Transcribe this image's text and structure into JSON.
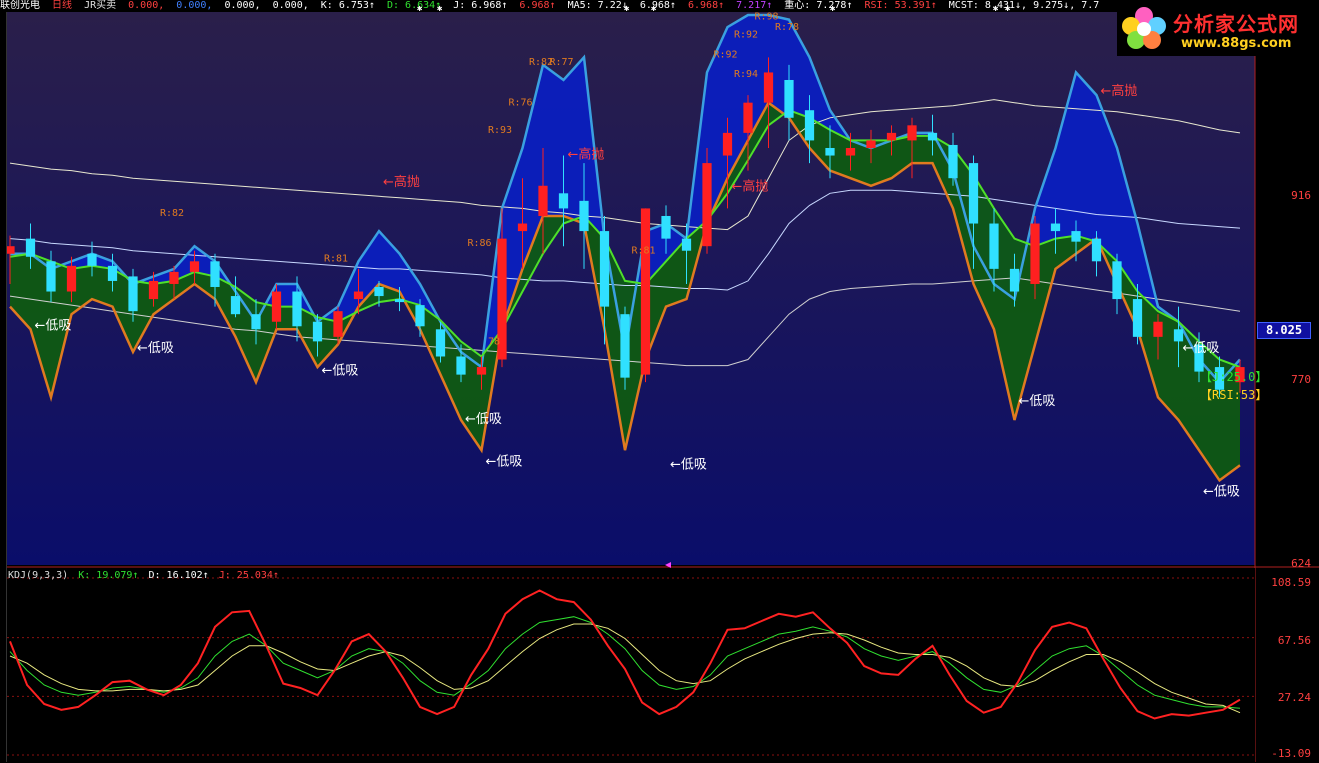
{
  "top_bar": {
    "stock_name": "联创光电",
    "period": "日线",
    "formula": "JR买卖",
    "vals1": [
      "0.000,",
      "0.000,",
      "0.000,",
      "0.000,"
    ],
    "k": "K: 6.753↑",
    "d": "D: 6.634↑",
    "j": "J: 6.968↑",
    "j2": "6.968↑",
    "ma5": "MA5: 7.22↓",
    "ma5b": "6.968↑",
    "ma5c": "6.968↑",
    "ma5d": "7.217↑",
    "zx": "重心: 7.278↑",
    "rsi": "RSI: 53.391↑",
    "mcst": "MCST: 8.431↓, 9.275↓, 7.7"
  },
  "logo": {
    "text": "分析家公式网",
    "url": "www.88gs.com"
  },
  "right_axis": {
    "price_labels": [
      "916",
      "770",
      "624"
    ],
    "current_price": "8.025",
    "indicator_labels": [
      "108.59",
      "67.56",
      "27.24",
      "-13.09"
    ]
  },
  "side_tags": {
    "j": "【J:25.0】",
    "rsi": "【RSI:53】"
  },
  "kdj_header": {
    "name": "KDJ(9,3,3)",
    "k": "K: 19.079↑",
    "d": "D: 16.102↑",
    "j": "J: 25.034↑"
  },
  "colors": {
    "bg_top": "#2a1f4a",
    "bg_bottom": "#0a0d6a",
    "up": "#ff2020",
    "down": "#30e0ff",
    "green_fill": "#0f5a12",
    "blue_fill": "#0b1fbf",
    "orange": "#e07a20",
    "cyanline": "#3aa0e0",
    "greenline": "#4ee02a",
    "kdj_red": "#ff2222",
    "kdj_green": "#30e030",
    "kdj_yellow": "#e8e880"
  },
  "chart_data": [
    {
      "type": "candlestick",
      "title": "",
      "ylim": [
        6.24,
        9.9
      ],
      "y_ticks": [
        9.16,
        7.7,
        6.24
      ],
      "annotations": [
        {
          "text": "R:82",
          "index": 8,
          "value": 8.55
        },
        {
          "text": "R:81",
          "index": 16,
          "value": 8.25
        },
        {
          "text": "R:86",
          "index": 23,
          "value": 8.35
        },
        {
          "text": "R:93",
          "index": 24,
          "value": 9.1
        },
        {
          "text": "R:76",
          "index": 25,
          "value": 9.28
        },
        {
          "text": "R:82",
          "index": 26,
          "value": 9.55
        },
        {
          "text": "R:77",
          "index": 27,
          "value": 9.55
        },
        {
          "text": "R:81",
          "index": 31,
          "value": 8.3
        },
        {
          "text": "R:92",
          "index": 36,
          "value": 9.73
        },
        {
          "text": "R:92",
          "index": 35,
          "value": 9.6
        },
        {
          "text": "R:94",
          "index": 36,
          "value": 9.47
        },
        {
          "text": "R:98",
          "index": 37,
          "value": 9.85
        },
        {
          "text": "R:78",
          "index": 38,
          "value": 9.78
        },
        {
          "text": "78",
          "index": 24,
          "value": 7.7
        }
      ],
      "signals": [
        {
          "text": "←低吸",
          "index": 1,
          "value": 7.8
        },
        {
          "text": "←低吸",
          "index": 6,
          "value": 7.65
        },
        {
          "text": "←低吸",
          "index": 15,
          "value": 7.5
        },
        {
          "text": "←高抛",
          "index": 18,
          "value": 8.75
        },
        {
          "text": "←低吸",
          "index": 22,
          "value": 7.18
        },
        {
          "text": "←低吸",
          "index": 23,
          "value": 6.9
        },
        {
          "text": "←高抛",
          "index": 27,
          "value": 8.93
        },
        {
          "text": "←低吸",
          "index": 32,
          "value": 6.88
        },
        {
          "text": "←高抛",
          "index": 35,
          "value": 8.72
        },
        {
          "text": "←高抛",
          "index": 39,
          "value": 10.1
        },
        {
          "text": "←低吸",
          "index": 49,
          "value": 7.3
        },
        {
          "text": "←高抛",
          "index": 53,
          "value": 9.35
        },
        {
          "text": "←低吸",
          "index": 57,
          "value": 7.65
        },
        {
          "text": "←低吸",
          "index": 58,
          "value": 6.7
        }
      ],
      "candles": [
        [
          8.3,
          8.42,
          8.35,
          8.1
        ],
        [
          8.4,
          8.5,
          8.28,
          8.2
        ],
        [
          8.25,
          8.32,
          8.05,
          7.98
        ],
        [
          8.05,
          8.28,
          8.22,
          7.98
        ],
        [
          8.3,
          8.38,
          8.22,
          8.15
        ],
        [
          8.22,
          8.3,
          8.12,
          8.05
        ],
        [
          8.15,
          8.2,
          7.92,
          7.85
        ],
        [
          8.0,
          8.18,
          8.12,
          7.95
        ],
        [
          8.1,
          8.22,
          8.18,
          8.0
        ],
        [
          8.18,
          8.32,
          8.25,
          8.1
        ],
        [
          8.25,
          8.3,
          8.08,
          7.95
        ],
        [
          8.02,
          8.15,
          7.9,
          7.88
        ],
        [
          7.9,
          8.0,
          7.8,
          7.7
        ],
        [
          7.85,
          8.1,
          8.05,
          7.8
        ],
        [
          8.05,
          8.15,
          7.82,
          7.72
        ],
        [
          7.85,
          7.9,
          7.72,
          7.62
        ],
        [
          7.75,
          7.95,
          7.92,
          7.7
        ],
        [
          8.0,
          8.2,
          8.05,
          7.9
        ],
        [
          8.08,
          8.12,
          8.02,
          7.95
        ],
        [
          8.0,
          8.08,
          7.98,
          7.92
        ],
        [
          7.96,
          8.0,
          7.82,
          7.75
        ],
        [
          7.8,
          7.85,
          7.62,
          7.58
        ],
        [
          7.62,
          7.7,
          7.5,
          7.45
        ],
        [
          7.5,
          7.62,
          7.55,
          7.4
        ],
        [
          7.6,
          8.6,
          8.4,
          7.55
        ],
        [
          8.45,
          8.8,
          8.5,
          8.2
        ],
        [
          8.55,
          9.0,
          8.75,
          8.3
        ],
        [
          8.7,
          8.95,
          8.6,
          8.35
        ],
        [
          8.65,
          8.9,
          8.45,
          8.2
        ],
        [
          8.45,
          8.55,
          7.95,
          7.7
        ],
        [
          7.9,
          7.95,
          7.48,
          7.4
        ],
        [
          7.5,
          8.6,
          8.6,
          7.45
        ],
        [
          8.55,
          8.62,
          8.4,
          8.3
        ],
        [
          8.4,
          8.5,
          8.32,
          8.1
        ],
        [
          8.35,
          9.0,
          8.9,
          8.3
        ],
        [
          8.95,
          9.2,
          9.1,
          8.6
        ],
        [
          9.1,
          9.35,
          9.3,
          8.85
        ],
        [
          9.3,
          9.6,
          9.5,
          9.0
        ],
        [
          9.45,
          9.55,
          9.2,
          9.05
        ],
        [
          9.25,
          9.35,
          9.05,
          8.9
        ],
        [
          9.0,
          9.15,
          8.95,
          8.8
        ],
        [
          8.95,
          9.1,
          9.0,
          8.85
        ],
        [
          9.0,
          9.12,
          9.05,
          8.9
        ],
        [
          9.05,
          9.15,
          9.1,
          8.95
        ],
        [
          9.05,
          9.2,
          9.15,
          8.8
        ],
        [
          9.1,
          9.22,
          9.05,
          8.95
        ],
        [
          9.02,
          9.1,
          8.8,
          8.75
        ],
        [
          8.9,
          8.95,
          8.5,
          8.2
        ],
        [
          8.5,
          8.6,
          8.2,
          8.05
        ],
        [
          8.2,
          8.3,
          8.05,
          7.95
        ],
        [
          8.1,
          8.55,
          8.5,
          8.0
        ],
        [
          8.5,
          8.6,
          8.45,
          8.3
        ],
        [
          8.45,
          8.52,
          8.38,
          8.25
        ],
        [
          8.4,
          8.45,
          8.25,
          8.15
        ],
        [
          8.25,
          8.3,
          8.0,
          7.9
        ],
        [
          8.0,
          8.1,
          7.75,
          7.7
        ],
        [
          7.75,
          7.9,
          7.85,
          7.6
        ],
        [
          7.8,
          7.95,
          7.72,
          7.55
        ],
        [
          7.7,
          7.78,
          7.52,
          7.45
        ],
        [
          7.55,
          7.62,
          7.4,
          7.35
        ],
        [
          7.45,
          7.6,
          7.55,
          7.38
        ]
      ],
      "ma_short": [
        8.28,
        8.3,
        8.25,
        8.2,
        8.22,
        8.2,
        8.12,
        8.1,
        8.12,
        8.18,
        8.15,
        8.08,
        7.98,
        7.95,
        7.95,
        7.88,
        7.85,
        7.92,
        7.98,
        8.0,
        7.96,
        7.86,
        7.72,
        7.62,
        7.8,
        8.05,
        8.3,
        8.5,
        8.55,
        8.4,
        8.12,
        8.1,
        8.25,
        8.4,
        8.52,
        8.7,
        8.92,
        9.15,
        9.25,
        9.2,
        9.12,
        9.05,
        9.05,
        9.05,
        9.08,
        9.08,
        9.0,
        8.82,
        8.6,
        8.4,
        8.35,
        8.4,
        8.42,
        8.38,
        8.25,
        8.05,
        7.92,
        7.85,
        7.72,
        7.6,
        7.55
      ],
      "mcst1": [
        8.9,
        8.88,
        8.86,
        8.85,
        8.83,
        8.82,
        8.8,
        8.79,
        8.78,
        8.77,
        8.76,
        8.75,
        8.74,
        8.73,
        8.72,
        8.71,
        8.7,
        8.69,
        8.68,
        8.67,
        8.66,
        8.65,
        8.64,
        8.62,
        8.61,
        8.6,
        8.58,
        8.57,
        8.55,
        8.54,
        8.52,
        8.5,
        8.49,
        8.48,
        8.47,
        8.46,
        8.55,
        8.8,
        9.05,
        9.15,
        9.2,
        9.22,
        9.24,
        9.25,
        9.26,
        9.27,
        9.28,
        9.3,
        9.32,
        9.3,
        9.28,
        9.27,
        9.26,
        9.25,
        9.24,
        9.22,
        9.2,
        9.18,
        9.15,
        9.12,
        9.1
      ],
      "mcst2": [
        8.4,
        8.39,
        8.37,
        8.36,
        8.35,
        8.34,
        8.32,
        8.31,
        8.3,
        8.29,
        8.28,
        8.27,
        8.26,
        8.25,
        8.24,
        8.23,
        8.22,
        8.21,
        8.2,
        8.2,
        8.19,
        8.18,
        8.17,
        8.16,
        8.14,
        8.13,
        8.12,
        8.12,
        8.11,
        8.1,
        8.09,
        8.09,
        8.08,
        8.07,
        8.07,
        8.06,
        8.12,
        8.3,
        8.5,
        8.62,
        8.7,
        8.72,
        8.72,
        8.72,
        8.71,
        8.7,
        8.69,
        8.68,
        8.66,
        8.64,
        8.62,
        8.6,
        8.58,
        8.56,
        8.55,
        8.54,
        8.52,
        8.5,
        8.49,
        8.48,
        8.47
      ],
      "mcst3": [
        8.02,
        8.0,
        7.98,
        7.96,
        7.94,
        7.92,
        7.9,
        7.88,
        7.86,
        7.84,
        7.82,
        7.8,
        7.79,
        7.77,
        7.75,
        7.74,
        7.73,
        7.72,
        7.71,
        7.7,
        7.69,
        7.68,
        7.67,
        7.66,
        7.65,
        7.64,
        7.63,
        7.62,
        7.61,
        7.6,
        7.59,
        7.58,
        7.57,
        7.56,
        7.56,
        7.56,
        7.6,
        7.75,
        7.9,
        8.0,
        8.05,
        8.07,
        8.08,
        8.09,
        8.1,
        8.1,
        8.11,
        8.12,
        8.13,
        8.14,
        8.12,
        8.1,
        8.08,
        8.06,
        8.04,
        8.02,
        8.0,
        7.98,
        7.96,
        7.94,
        7.92
      ],
      "band_upper": [
        8.3,
        8.3,
        8.2,
        8.25,
        8.3,
        8.25,
        8.1,
        8.15,
        8.2,
        8.35,
        8.25,
        8.05,
        7.85,
        8.1,
        8.1,
        7.85,
        7.95,
        8.25,
        8.45,
        8.3,
        8.1,
        7.85,
        7.65,
        7.55,
        8.6,
        9.0,
        9.55,
        9.45,
        9.6,
        8.4,
        7.65,
        8.45,
        8.5,
        8.4,
        9.5,
        9.8,
        9.88,
        9.88,
        9.85,
        9.6,
        9.25,
        9.05,
        9.0,
        9.05,
        9.1,
        9.1,
        8.85,
        8.35,
        8.1,
        8.0,
        8.6,
        9.0,
        9.5,
        9.35,
        9.0,
        8.5,
        7.95,
        7.85,
        7.6,
        7.45,
        7.6
      ],
      "band_lower": [
        7.95,
        7.8,
        7.35,
        7.9,
        8.0,
        7.95,
        7.65,
        7.9,
        8.0,
        8.1,
        8.0,
        7.75,
        7.45,
        7.8,
        7.8,
        7.55,
        7.7,
        7.95,
        8.1,
        8.05,
        7.8,
        7.5,
        7.2,
        7.0,
        7.8,
        8.2,
        8.55,
        8.55,
        8.5,
        7.8,
        7.0,
        7.6,
        7.95,
        8.0,
        8.5,
        8.8,
        9.05,
        9.3,
        9.2,
        9.0,
        8.85,
        8.8,
        8.75,
        8.8,
        8.9,
        8.9,
        8.6,
        8.1,
        7.8,
        7.2,
        7.7,
        8.2,
        8.3,
        8.4,
        8.1,
        7.8,
        7.35,
        7.2,
        7.0,
        6.8,
        6.9
      ]
    },
    {
      "type": "line",
      "title": "KDJ(9,3,3)",
      "ylim": [
        -13.09,
        108.59
      ],
      "y_ticks": [
        108.59,
        67.56,
        27.24,
        -13.09
      ],
      "series": [
        {
          "name": "K",
          "values": [
            58,
            45,
            35,
            30,
            28,
            30,
            33,
            34,
            32,
            30,
            33,
            40,
            55,
            65,
            70,
            62,
            50,
            45,
            40,
            45,
            55,
            60,
            58,
            50,
            38,
            30,
            28,
            36,
            45,
            60,
            70,
            78,
            80,
            82,
            78,
            70,
            60,
            45,
            35,
            32,
            34,
            42,
            55,
            60,
            65,
            70,
            72,
            75,
            72,
            68,
            60,
            55,
            52,
            55,
            58,
            50,
            40,
            32,
            30,
            35,
            45,
            55,
            60,
            62,
            55,
            45,
            35,
            28,
            25,
            22,
            20,
            20,
            19
          ]
        },
        {
          "name": "D",
          "values": [
            55,
            50,
            42,
            36,
            32,
            31,
            31,
            32,
            32,
            31,
            32,
            35,
            45,
            55,
            62,
            62,
            57,
            51,
            46,
            45,
            50,
            55,
            58,
            55,
            47,
            38,
            32,
            33,
            38,
            48,
            58,
            67,
            73,
            77,
            77,
            74,
            67,
            56,
            45,
            38,
            36,
            38,
            46,
            53,
            58,
            63,
            67,
            70,
            71,
            70,
            66,
            61,
            57,
            56,
            56,
            54,
            48,
            40,
            35,
            34,
            38,
            45,
            51,
            56,
            56,
            51,
            44,
            36,
            30,
            26,
            22,
            21,
            16
          ]
        },
        {
          "name": "J",
          "values": [
            65,
            35,
            22,
            18,
            20,
            28,
            37,
            38,
            32,
            28,
            35,
            50,
            75,
            85,
            86,
            62,
            36,
            33,
            28,
            45,
            65,
            70,
            58,
            40,
            20,
            15,
            20,
            42,
            60,
            84,
            94,
            100,
            94,
            92,
            80,
            62,
            46,
            23,
            15,
            20,
            30,
            50,
            73,
            74,
            79,
            84,
            82,
            85,
            74,
            64,
            48,
            43,
            42,
            53,
            62,
            42,
            24,
            16,
            20,
            37,
            59,
            75,
            78,
            74,
            53,
            33,
            17,
            12,
            15,
            14,
            16,
            18,
            25
          ]
        }
      ]
    }
  ]
}
